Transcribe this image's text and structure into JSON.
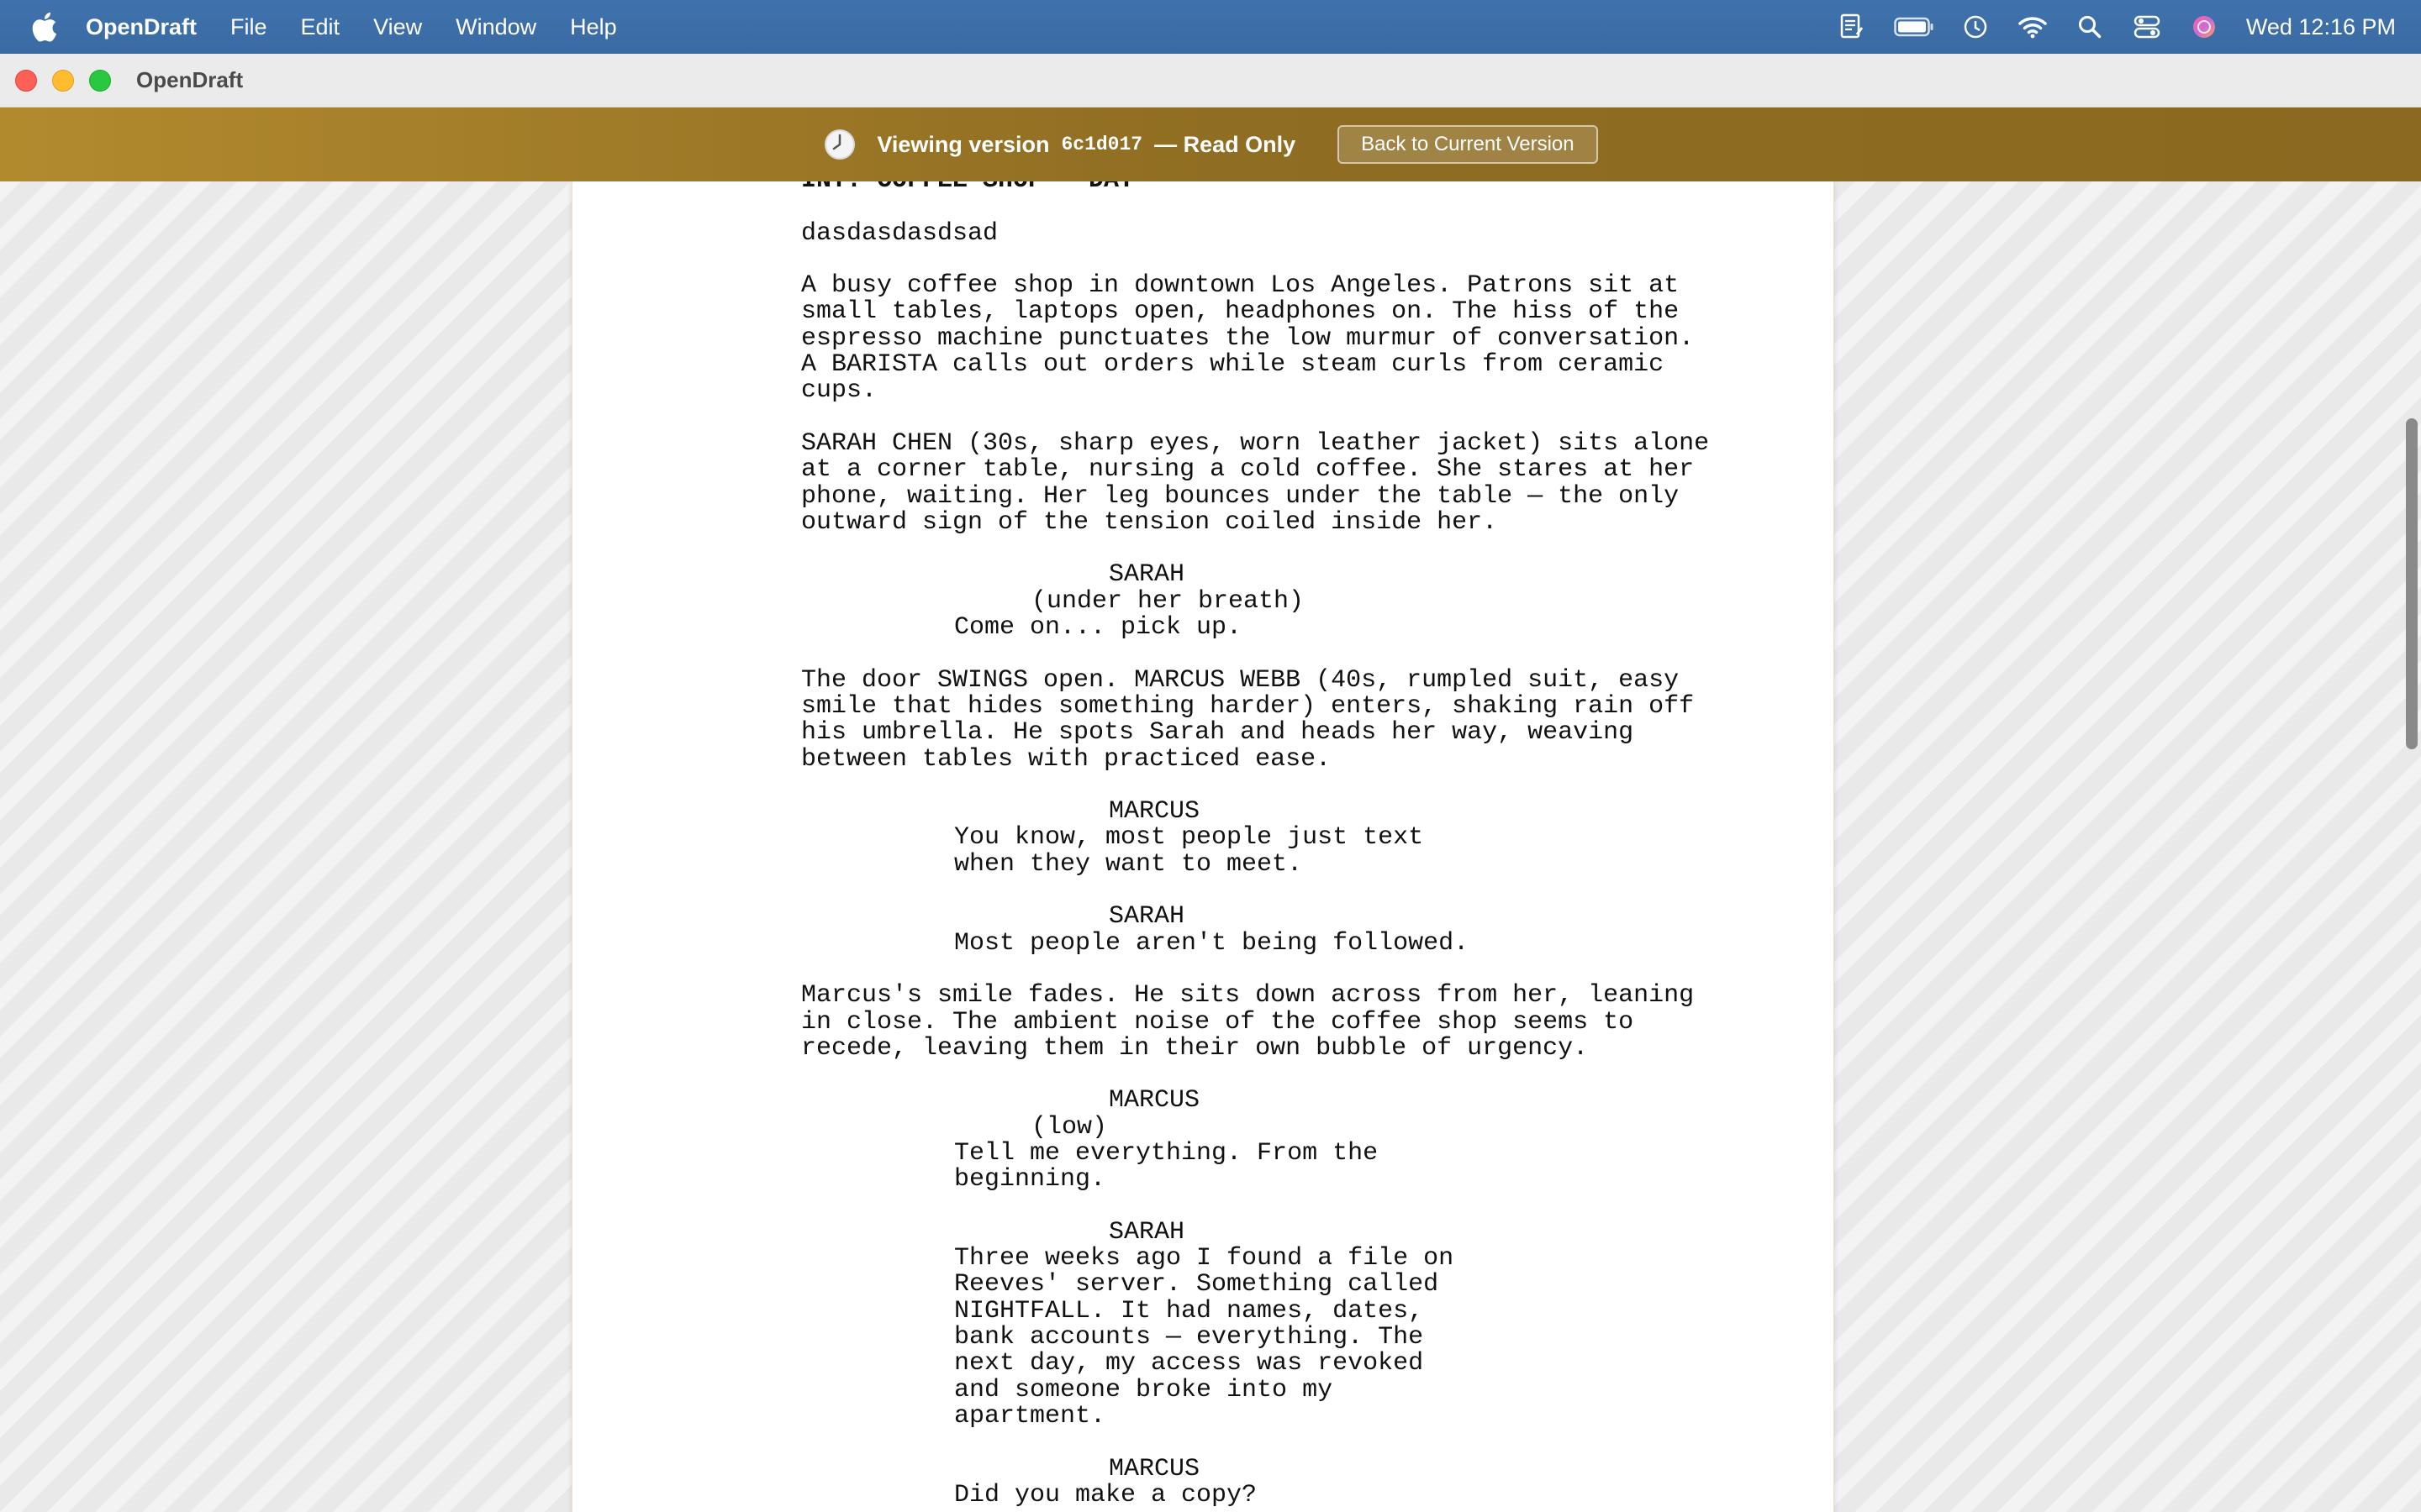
{
  "menubar": {
    "app_name": "OpenDraft",
    "items": [
      "File",
      "Edit",
      "View",
      "Window",
      "Help"
    ],
    "clock": "Wed 12:16 PM",
    "status_icons": [
      "script-icon",
      "battery-icon",
      "time-machine-icon",
      "wifi-icon",
      "spotlight-search-icon",
      "control-center-icon",
      "siri-icon"
    ]
  },
  "window": {
    "title": "OpenDraft"
  },
  "banner": {
    "prefix": "Viewing version",
    "hash": "6c1d017",
    "suffix": "— Read Only",
    "back_button": "Back to Current Version"
  },
  "script": {
    "lines": [
      {
        "type": "scene",
        "text": "INT. COFFEE SHOP - DAY"
      },
      {
        "type": "blank",
        "text": ""
      },
      {
        "type": "action",
        "text": "dasdasdasdsad"
      },
      {
        "type": "blank",
        "text": ""
      },
      {
        "type": "action",
        "text": "A busy coffee shop in downtown Los Angeles. Patrons sit at"
      },
      {
        "type": "action",
        "text": "small tables, laptops open, headphones on. The hiss of the"
      },
      {
        "type": "action",
        "text": "espresso machine punctuates the low murmur of conversation."
      },
      {
        "type": "action",
        "text": "A BARISTA calls out orders while steam curls from ceramic"
      },
      {
        "type": "action",
        "text": "cups."
      },
      {
        "type": "blank",
        "text": ""
      },
      {
        "type": "action",
        "text": "SARAH CHEN (30s, sharp eyes, worn leather jacket) sits alone"
      },
      {
        "type": "action",
        "text": "at a corner table, nursing a cold coffee. She stares at her"
      },
      {
        "type": "action",
        "text": "phone, waiting. Her leg bounces under the table — the only"
      },
      {
        "type": "action",
        "text": "outward sign of the tension coiled inside her."
      },
      {
        "type": "blank",
        "text": ""
      },
      {
        "type": "character",
        "text": "SARAH"
      },
      {
        "type": "paren",
        "text": "(under her breath)"
      },
      {
        "type": "dialogue",
        "text": "Come on... pick up."
      },
      {
        "type": "blank",
        "text": ""
      },
      {
        "type": "action",
        "text": "The door SWINGS open. MARCUS WEBB (40s, rumpled suit, easy"
      },
      {
        "type": "action",
        "text": "smile that hides something harder) enters, shaking rain off"
      },
      {
        "type": "action",
        "text": "his umbrella. He spots Sarah and heads her way, weaving"
      },
      {
        "type": "action",
        "text": "between tables with practiced ease."
      },
      {
        "type": "blank",
        "text": ""
      },
      {
        "type": "character",
        "text": "MARCUS"
      },
      {
        "type": "dialogue",
        "text": "You know, most people just text"
      },
      {
        "type": "dialogue",
        "text": "when they want to meet."
      },
      {
        "type": "blank",
        "text": ""
      },
      {
        "type": "character",
        "text": "SARAH"
      },
      {
        "type": "dialogue",
        "text": "Most people aren't being followed."
      },
      {
        "type": "blank",
        "text": ""
      },
      {
        "type": "action",
        "text": "Marcus's smile fades. He sits down across from her, leaning"
      },
      {
        "type": "action",
        "text": "in close. The ambient noise of the coffee shop seems to"
      },
      {
        "type": "action",
        "text": "recede, leaving them in their own bubble of urgency."
      },
      {
        "type": "blank",
        "text": ""
      },
      {
        "type": "character",
        "text": "MARCUS"
      },
      {
        "type": "paren",
        "text": "(low)"
      },
      {
        "type": "dialogue",
        "text": "Tell me everything. From the"
      },
      {
        "type": "dialogue",
        "text": "beginning."
      },
      {
        "type": "blank",
        "text": ""
      },
      {
        "type": "character",
        "text": "SARAH"
      },
      {
        "type": "dialogue",
        "text": "Three weeks ago I found a file on"
      },
      {
        "type": "dialogue",
        "text": "Reeves' server. Something called"
      },
      {
        "type": "dialogue",
        "text": "NIGHTFALL. It had names, dates,"
      },
      {
        "type": "dialogue",
        "text": "bank accounts — everything. The"
      },
      {
        "type": "dialogue",
        "text": "next day, my access was revoked"
      },
      {
        "type": "dialogue",
        "text": "and someone broke into my"
      },
      {
        "type": "dialogue",
        "text": "apartment."
      },
      {
        "type": "blank",
        "text": ""
      },
      {
        "type": "character",
        "text": "MARCUS"
      },
      {
        "type": "dialogue",
        "text": "Did you make a copy?"
      }
    ]
  }
}
